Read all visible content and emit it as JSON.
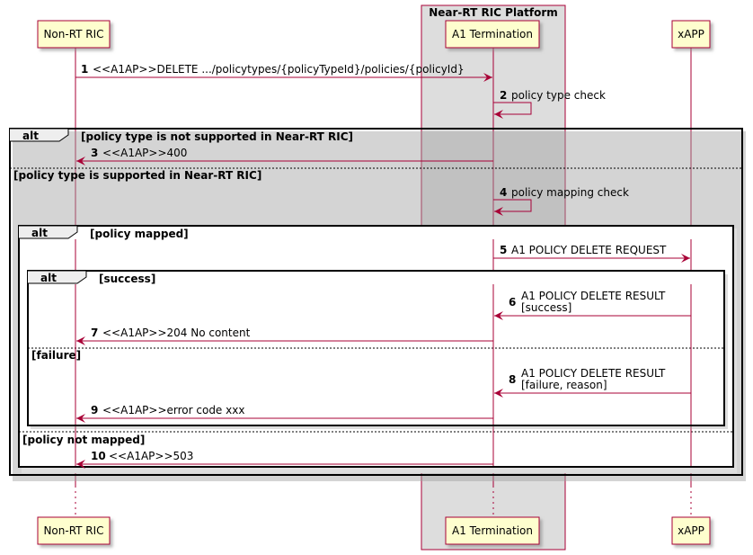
{
  "participants": {
    "non_rt_ric": "Non-RT RIC",
    "a1_termination": "A1 Termination",
    "xapp": "xAPP"
  },
  "box": {
    "title": "Near-RT RIC Platform"
  },
  "messages": [
    {
      "num": "1",
      "text": "<<A1AP>>DELETE .../policytypes/{policyTypeId}/policies/{policyId}"
    },
    {
      "num": "2",
      "text": "policy type check"
    },
    {
      "num": "3",
      "text": "<<A1AP>>400"
    },
    {
      "num": "4",
      "text": "policy mapping check"
    },
    {
      "num": "5",
      "text": "A1 POLICY DELETE REQUEST"
    },
    {
      "num": "6",
      "line1": "A1 POLICY DELETE RESULT",
      "line2": "[success]"
    },
    {
      "num": "7",
      "text": "<<A1AP>>204 No content"
    },
    {
      "num": "8",
      "line1": "A1 POLICY DELETE RESULT",
      "line2": "[failure, reason]"
    },
    {
      "num": "9",
      "text": "<<A1AP>>error code xxx"
    },
    {
      "num": "10",
      "text": "<<A1AP>>503"
    }
  ],
  "fragments": {
    "outer": {
      "keyword": "alt",
      "condition": "[policy type is not supported in Near-RT RIC]",
      "else": "[policy type is supported in Near-RT RIC]"
    },
    "middle": {
      "keyword": "alt",
      "condition": "[policy mapped]",
      "else": "[policy not mapped]"
    },
    "inner": {
      "keyword": "alt",
      "condition": "[success]",
      "else": "[failure]"
    }
  },
  "colors": {
    "arrow": "#a80036",
    "participant_fill": "#fefece",
    "participant_border": "#a80036",
    "box_fill": "#dddddd"
  }
}
